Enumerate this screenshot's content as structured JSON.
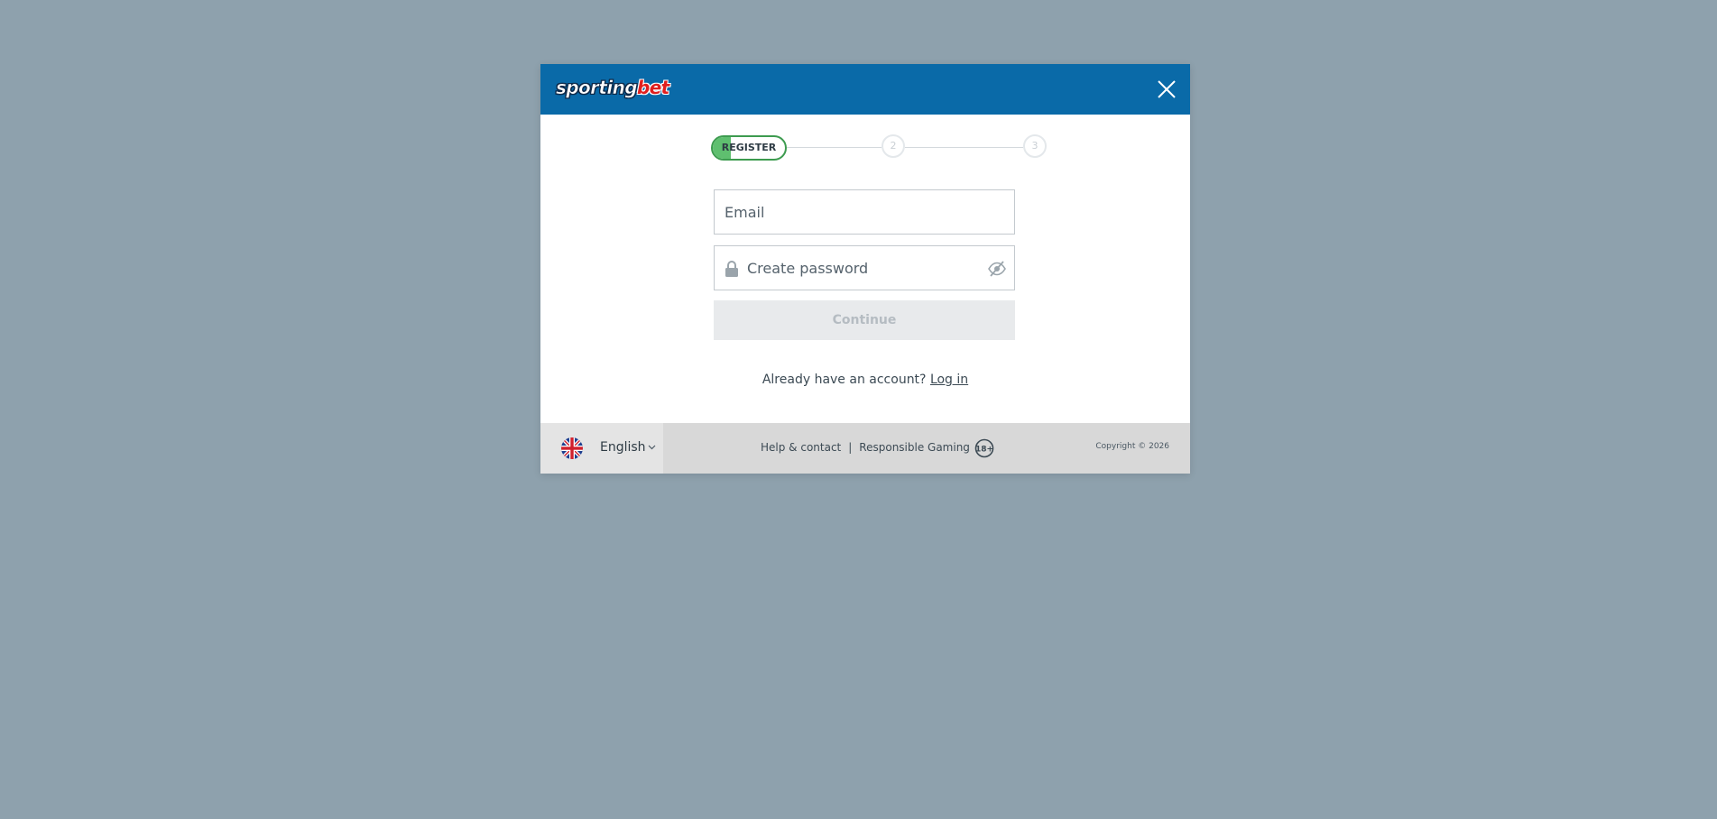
{
  "header": {
    "logo_part1": "sporting",
    "logo_part2": "bet",
    "close_icon": "close-icon"
  },
  "stepper": {
    "active_step_label": "REGISTER",
    "step2_label": "2",
    "step3_label": "3",
    "colors": {
      "active_border": "#3d9b4f",
      "active_fill": "#5fbf6f",
      "inactive": "#e4e8eb"
    }
  },
  "form": {
    "email_placeholder": "Email",
    "email_value": "",
    "password_placeholder": "Create password",
    "password_value": "",
    "lock_icon": "lock-icon",
    "visibility_icon": "eye-off-icon",
    "continue_label": "Continue"
  },
  "login": {
    "prompt": "Already have an account?",
    "link_label": "Log in"
  },
  "footer": {
    "language": "English",
    "flag_icon": "uk-flag-icon",
    "help_label": "Help & contact",
    "separator": "|",
    "responsible_label": "Responsible Gaming",
    "age_badge": "18+",
    "copyright": "Copyright © 2026"
  },
  "colors": {
    "backdrop": "#8ea1ad",
    "header_bg": "#0a6aa8",
    "footer_bg": "#d8d8d8",
    "button_disabled_bg": "#e8eaec",
    "brand_red": "#e0201f"
  }
}
